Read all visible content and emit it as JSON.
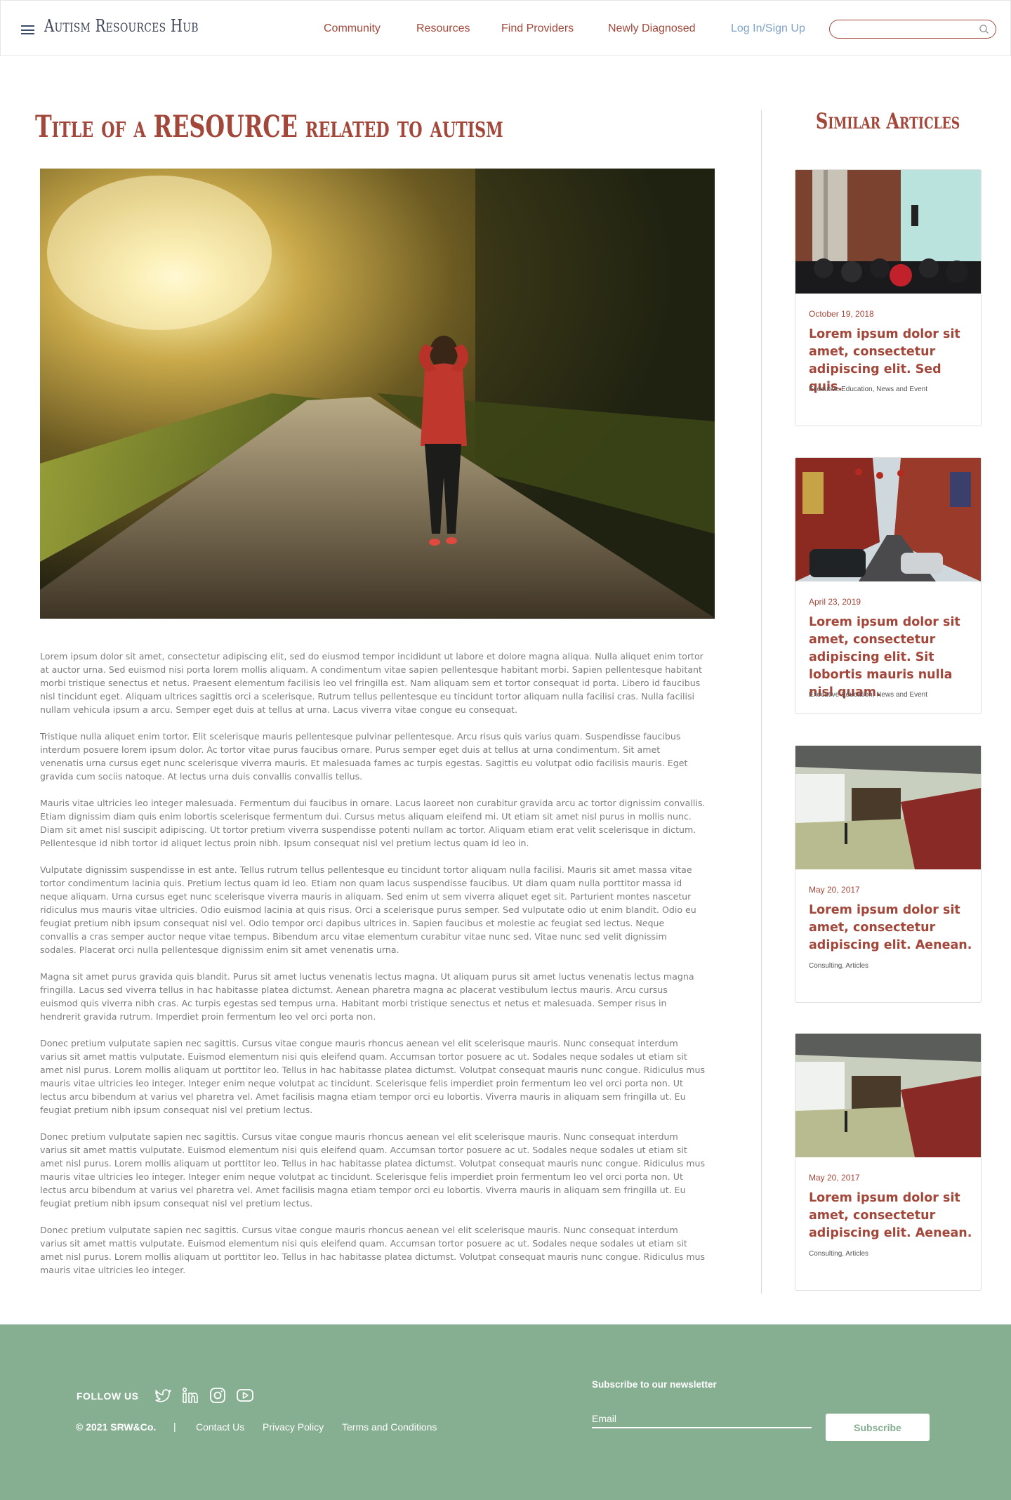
{
  "header": {
    "brand": "Autism Resources Hub",
    "nav": [
      {
        "label": "Community"
      },
      {
        "label": "Resources"
      },
      {
        "label": "Find Providers"
      },
      {
        "label": "Newly Diagnosed"
      },
      {
        "label": "Log In/Sign Up"
      }
    ],
    "search_placeholder": ""
  },
  "article": {
    "title": "Title of a RESOURCE related to autism",
    "paragraphs": [
      "Lorem ipsum dolor sit amet, consectetur adipiscing elit, sed do eiusmod tempor incididunt ut labore et dolore magna aliqua. Nulla aliquet enim tortor at auctor urna. Sed euismod nisi porta lorem mollis aliquam. A condimentum vitae sapien pellentesque habitant morbi. Sapien pellentesque habitant morbi tristique senectus et netus. Praesent elementum facilisis leo vel fringilla est. Nam aliquam sem et tortor consequat id porta. Libero id faucibus nisl tincidunt eget. Aliquam ultrices sagittis orci a scelerisque. Rutrum tellus pellentesque eu tincidunt tortor aliquam nulla facilisi cras. Nulla facilisi nullam vehicula ipsum a arcu. Semper eget duis at tellus at urna. Lacus viverra vitae congue eu consequat.",
      "Tristique nulla aliquet enim tortor. Elit scelerisque mauris pellentesque pulvinar pellentesque. Arcu risus quis varius quam. Suspendisse faucibus interdum posuere lorem ipsum dolor. Ac tortor vitae purus faucibus ornare. Purus semper eget duis at tellus at urna condimentum. Sit amet venenatis urna cursus eget nunc scelerisque viverra mauris. Et malesuada fames ac turpis egestas. Sagittis eu volutpat odio facilisis mauris. Eget gravida cum sociis natoque. At lectus urna duis convallis convallis tellus.",
      "Mauris vitae ultricies leo integer malesuada. Fermentum dui faucibus in ornare. Lacus laoreet non curabitur gravida arcu ac tortor dignissim convallis. Etiam dignissim diam quis enim lobortis scelerisque fermentum dui. Cursus metus aliquam eleifend mi. Ut etiam sit amet nisl purus in mollis nunc. Diam sit amet nisl suscipit adipiscing. Ut tortor pretium viverra suspendisse potenti nullam ac tortor. Aliquam etiam erat velit scelerisque in dictum. Pellentesque id nibh tortor id aliquet lectus proin nibh. Ipsum consequat nisl vel pretium lectus quam id leo in.",
      "Vulputate dignissim suspendisse in est ante. Tellus rutrum tellus pellentesque eu tincidunt tortor aliquam nulla facilisi. Mauris sit amet massa vitae tortor condimentum lacinia quis. Pretium lectus quam id leo. Etiam non quam lacus suspendisse faucibus. Ut diam quam nulla porttitor massa id neque aliquam. Urna cursus eget nunc scelerisque viverra mauris in aliquam. Sed enim ut sem viverra aliquet eget sit. Parturient montes nascetur ridiculus mus mauris vitae ultricies. Odio euismod lacinia at quis risus. Orci a scelerisque purus semper. Sed vulputate odio ut enim blandit. Odio eu feugiat pretium nibh ipsum consequat nisl vel. Odio tempor orci dapibus ultrices in. Sapien faucibus et molestie ac feugiat sed lectus. Neque convallis a cras semper auctor neque vitae tempus. Bibendum arcu vitae elementum curabitur vitae nunc sed. Vitae nunc sed velit dignissim sodales. Placerat orci nulla pellentesque dignissim enim sit amet venenatis urna.",
      "Magna sit amet purus gravida quis blandit. Purus sit amet luctus venenatis lectus magna. Ut aliquam purus sit amet luctus venenatis lectus magna fringilla. Lacus sed viverra tellus in hac habitasse platea dictumst. Aenean pharetra magna ac placerat vestibulum lectus mauris. Arcu cursus euismod quis viverra nibh cras. Ac turpis egestas sed tempus urna. Habitant morbi tristique senectus et netus et malesuada. Semper risus in hendrerit gravida rutrum. Imperdiet proin fermentum leo vel orci porta non.",
      "Donec pretium vulputate sapien nec sagittis. Cursus vitae congue mauris rhoncus aenean vel elit scelerisque mauris. Nunc consequat interdum varius sit amet mattis vulputate. Euismod elementum nisi quis eleifend quam. Accumsan tortor posuere ac ut. Sodales neque sodales ut etiam sit amet nisl purus. Lorem mollis aliquam ut porttitor leo. Tellus in hac habitasse platea dictumst. Volutpat consequat mauris nunc congue. Ridiculus mus mauris vitae ultricies leo integer. Integer enim neque volutpat ac tincidunt. Scelerisque felis imperdiet proin fermentum leo vel orci porta non. Ut lectus arcu bibendum at varius vel pharetra vel. Amet facilisis magna etiam tempor orci eu lobortis. Viverra mauris in aliquam sem fringilla ut. Eu feugiat pretium nibh ipsum consequat nisl vel pretium lectus.",
      "Donec pretium vulputate sapien nec sagittis. Cursus vitae congue mauris rhoncus aenean vel elit scelerisque mauris. Nunc consequat interdum varius sit amet mattis vulputate. Euismod elementum nisi quis eleifend quam. Accumsan tortor posuere ac ut. Sodales neque sodales ut etiam sit amet nisl purus. Lorem mollis aliquam ut porttitor leo. Tellus in hac habitasse platea dictumst. Volutpat consequat mauris nunc congue. Ridiculus mus mauris vitae ultricies leo integer. Integer enim neque volutpat ac tincidunt. Scelerisque felis imperdiet proin fermentum leo vel orci porta non. Ut lectus arcu bibendum at varius vel pharetra vel. Amet facilisis magna etiam tempor orci eu lobortis. Viverra mauris in aliquam sem fringilla ut. Eu feugiat pretium nibh ipsum consequat nisl vel pretium lectus.",
      "Donec pretium vulputate sapien nec sagittis. Cursus vitae congue mauris rhoncus aenean vel elit scelerisque mauris. Nunc consequat interdum varius sit amet mattis vulputate. Euismod elementum nisi quis eleifend quam. Accumsan tortor posuere ac ut. Sodales neque sodales ut etiam sit amet nisl purus. Lorem mollis aliquam ut porttitor leo. Tellus in hac habitasse platea dictumst. Volutpat consequat mauris nunc congue. Ridiculus mus mauris vitae ultricies leo integer."
    ]
  },
  "sidebar": {
    "title": "Similar Articles",
    "cards": [
      {
        "date": "October 19, 2018",
        "title": "Lorem ipsum dolor sit amet, consectetur adipiscing elit. Sed quis.",
        "tags": "Executive Education, News and Event"
      },
      {
        "date": "April 23, 2019",
        "title": "Lorem ipsum dolor sit amet, consectetur adipiscing elit. Sit lobortis mauris nulla nisl quam.",
        "tags": "Executive Education, News and Event"
      },
      {
        "date": "May 20, 2017",
        "title": "Lorem ipsum dolor sit amet, consectetur adipiscing elit. Aenean.",
        "tags": "Consulting, Articles"
      },
      {
        "date": "May 20, 2017",
        "title": "Lorem ipsum dolor sit amet, consectetur adipiscing elit. Aenean.",
        "tags": "Consulting, Articles"
      }
    ]
  },
  "footer": {
    "follow_label": "FOLLOW US",
    "social_icons": [
      "twitter-icon",
      "linkedin-icon",
      "instagram-icon",
      "youtube-icon"
    ],
    "copyright": "© 2021 SRW&Co.",
    "separator": "|",
    "links": [
      {
        "label": "Contact Us"
      },
      {
        "label": "Privacy Policy"
      },
      {
        "label": "Terms and Conditions"
      }
    ],
    "newsletter_label": "Subscribe to our newsletter",
    "email_placeholder": "Email",
    "subscribe_label": "Subscribe"
  },
  "colors": {
    "accent": "#a3473a",
    "footer_bg": "#86ae91",
    "login_link": "#7fa2c8",
    "brand_text": "#3d4354"
  }
}
